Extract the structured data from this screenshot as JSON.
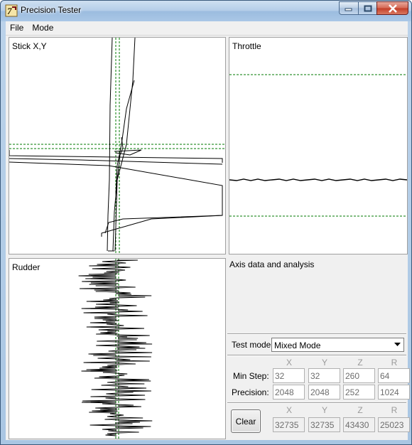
{
  "window": {
    "title": "Precision Tester",
    "colors": {
      "trace": "#000000",
      "guide": "#007a00"
    }
  },
  "menu": {
    "file": "File",
    "mode": "Mode"
  },
  "panels": {
    "stick": {
      "label": "Stick X,Y"
    },
    "throttle": {
      "label": "Throttle"
    },
    "rudder": {
      "label": "Rudder"
    }
  },
  "analysis": {
    "label": "Axis data and analysis",
    "test_mode_label": "Test mode:",
    "test_mode_value": "Mixed Mode",
    "columns": [
      "X",
      "Y",
      "Z",
      "R"
    ],
    "min_step_label": "Min Step:",
    "min_step": [
      "32",
      "32",
      "260",
      "64"
    ],
    "precision_label": "Precision:",
    "precision": [
      "2048",
      "2048",
      "252",
      "1024"
    ],
    "raw": [
      "32735",
      "32735",
      "43430",
      "25023"
    ]
  },
  "buttons": {
    "clear": "Clear"
  }
}
